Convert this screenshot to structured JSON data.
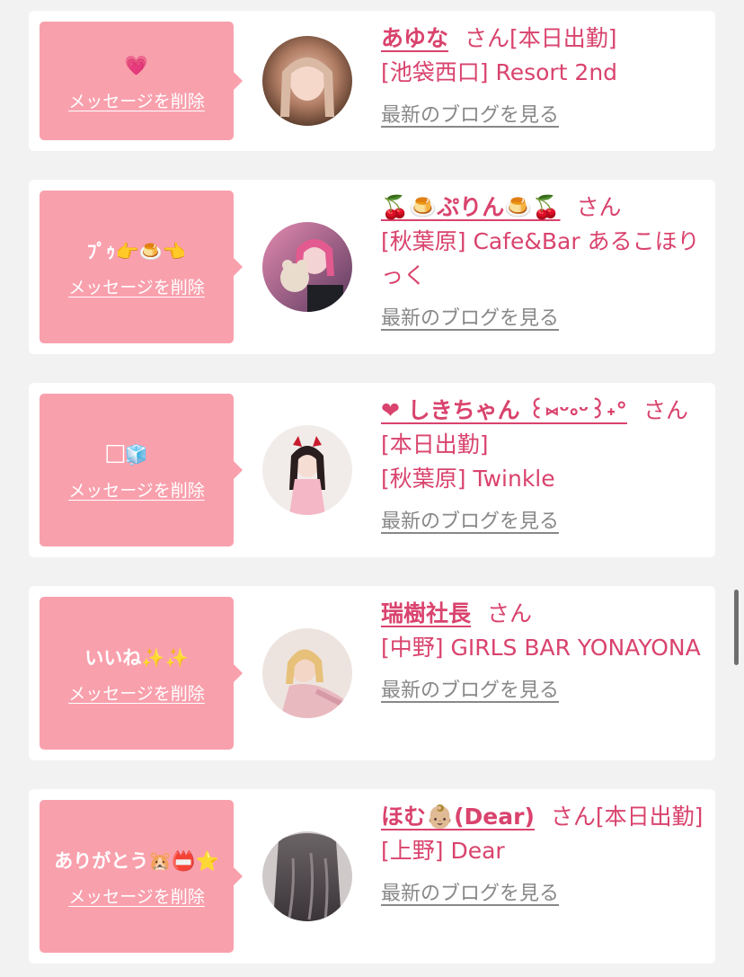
{
  "cards": [
    {
      "message": "💗",
      "delete_label": "メッセージを削除",
      "name": "あゆな",
      "suffix": "さん[本日出勤]",
      "shop": "[池袋西口] Resort 2nd",
      "blog_label": "最新のブログを見る"
    },
    {
      "message": "ﾌﾟｩ👉🍮👈",
      "delete_label": "メッセージを削除",
      "name": "🍒🍮ぷりん🍮🍒",
      "suffix": "さん",
      "shop": "[秋葉原] Cafe&Bar あるこほりっく",
      "blog_label": "最新のブログを見る"
    },
    {
      "message": "⃞🧊",
      "delete_label": "メッセージを削除",
      "name": "❤︎ しきちゃん ꒰⑅ᵕ༚ᵕ꒱˖°",
      "suffix": "さん[本日出勤]",
      "shop": "[秋葉原] Twinkle",
      "blog_label": "最新のブログを見る"
    },
    {
      "message": "いいね✨✨",
      "delete_label": "メッセージを削除",
      "name": "瑞樹社長",
      "suffix": "さん",
      "shop": "[中野] GIRLS BAR YONAYONA",
      "blog_label": "最新のブログを見る"
    },
    {
      "message": "ありがとう🐹📛⭐",
      "delete_label": "メッセージを削除",
      "name": "ほむ👶🏼(Dear)",
      "suffix": "さん[本日出勤]",
      "shop": "[上野] Dear",
      "blog_label": "最新のブログを見る"
    }
  ],
  "colors": {
    "accent": "#d9436d",
    "bubble": "#f9a0ad",
    "link_gray": "#888888",
    "background": "#f2f2f3"
  }
}
